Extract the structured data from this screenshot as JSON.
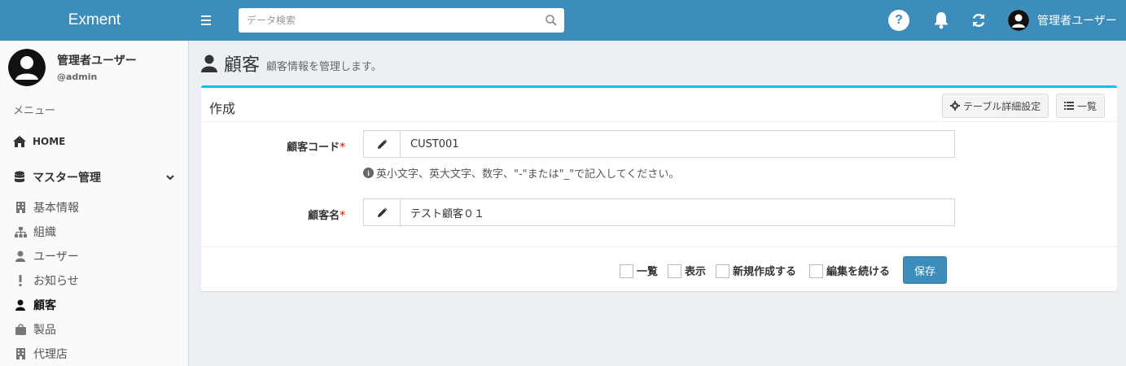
{
  "header": {
    "logo": "Exment",
    "search_placeholder": "データ検索",
    "help_label": "?",
    "user_name": "管理者ユーザー"
  },
  "sidebar": {
    "user_name": "管理者ユーザー",
    "user_id": "@admin",
    "menu_header": "メニュー",
    "home_label": "HOME",
    "master_label": "マスター管理",
    "items": [
      {
        "label": "基本情報",
        "icon": "building-icon"
      },
      {
        "label": "組織",
        "icon": "sitemap-icon"
      },
      {
        "label": "ユーザー",
        "icon": "user-icon"
      },
      {
        "label": "お知らせ",
        "icon": "exclamation-icon"
      },
      {
        "label": "顧客",
        "icon": "user-icon",
        "active": true
      },
      {
        "label": "製品",
        "icon": "shopping-bag-icon"
      },
      {
        "label": "代理店",
        "icon": "building-icon"
      }
    ]
  },
  "page": {
    "title": "顧客",
    "subtitle": "顧客情報を管理します。"
  },
  "box": {
    "title": "作成",
    "table_setting_label": "テーブル詳細設定",
    "list_label": "一覧"
  },
  "form": {
    "code_label": "顧客コード",
    "code_value": "CUST001",
    "code_help": "英小文字、英大文字、数字、\"-\"または\"_\"で記入してください。",
    "name_label": "顧客名",
    "name_value": "テスト顧客０１",
    "required_mark": "*"
  },
  "footer": {
    "chk_list": "一覧",
    "chk_view": "表示",
    "chk_new": "新規作成する",
    "chk_continue": "編集を続ける",
    "save_label": "保存"
  },
  "colors": {
    "header_bg": "#3c8dbc",
    "box_accent": "#00c0ef",
    "required": "#dd4b39"
  }
}
